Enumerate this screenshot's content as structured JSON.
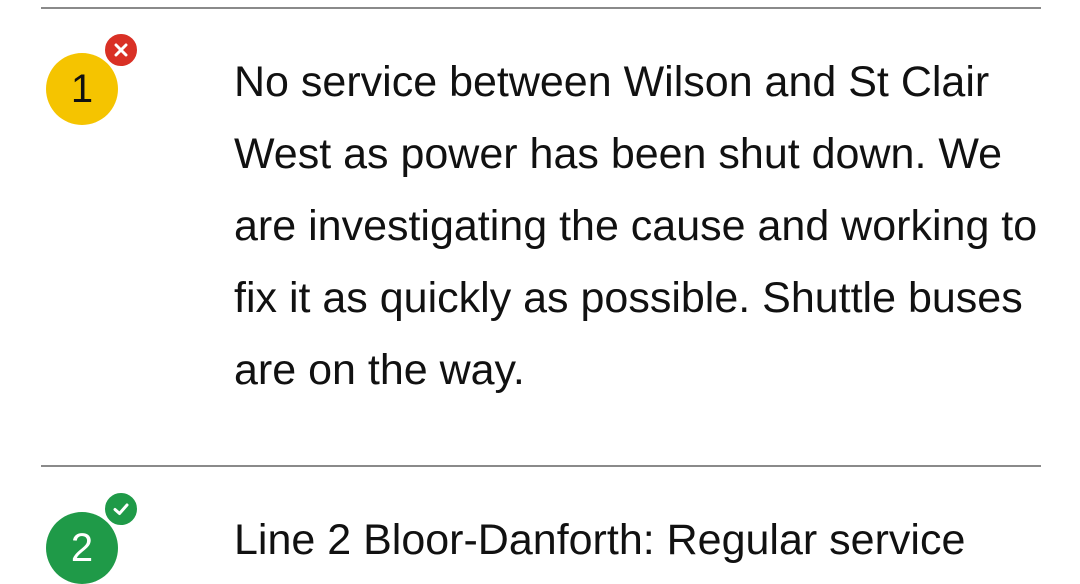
{
  "alerts": [
    {
      "line_number": "1",
      "line_color": "#f5c400",
      "status": "disrupted",
      "status_icon": "close-icon",
      "status_color": "#d93025",
      "message": "No service between Wilson and St Clair West as power has been shut down. We are investigating the cause and working to fix it as quickly as possible. Shuttle buses are on the way."
    },
    {
      "line_number": "2",
      "line_color": "#1f9a48",
      "status": "resolved",
      "status_icon": "check-icon",
      "status_color": "#1f9a48",
      "message": "Line 2 Bloor-Danforth: Regular service"
    }
  ]
}
